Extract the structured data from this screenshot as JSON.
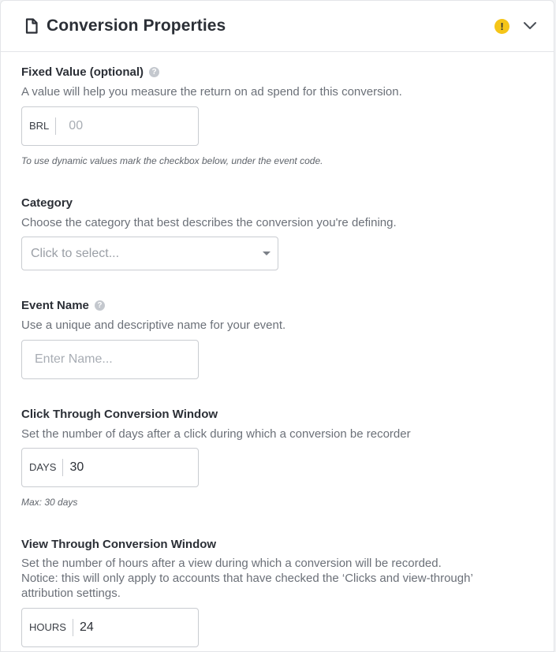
{
  "header": {
    "title": "Conversion Properties",
    "warning_glyph": "!",
    "icons": {
      "doc": "document-icon",
      "warning": "warning-icon",
      "chevron": "chevron-down-icon"
    },
    "warning_color": "#f5c518"
  },
  "fixed_value": {
    "label": "Fixed Value (optional)",
    "help": "?",
    "description": "A value will help you measure the return on ad spend for this conversion.",
    "prefix": "BRL",
    "placeholder": "00",
    "note": "To use dynamic values mark the checkbox below, under the event code."
  },
  "category": {
    "label": "Category",
    "description": "Choose the category that best describes the conversion you're defining.",
    "placeholder": "Click to select..."
  },
  "event_name": {
    "label": "Event Name",
    "help": "?",
    "description": "Use a unique and descriptive name for your event.",
    "placeholder": "Enter Name..."
  },
  "click_through": {
    "label": "Click Through Conversion Window",
    "description": "Set the number of days after a click during which a conversion be recorder",
    "prefix": "DAYS",
    "value": "30",
    "note": "Max: 30 days"
  },
  "view_through": {
    "label": "View Through Conversion Window",
    "description_line1": "Set the number of hours after a view during which a conversion will be recorded.",
    "description_line2": "Notice: this will only apply to accounts that have checked the ‘Clicks and view-through’",
    "description_line3": "attribution settings.",
    "prefix": "HOURS",
    "value": "24"
  }
}
